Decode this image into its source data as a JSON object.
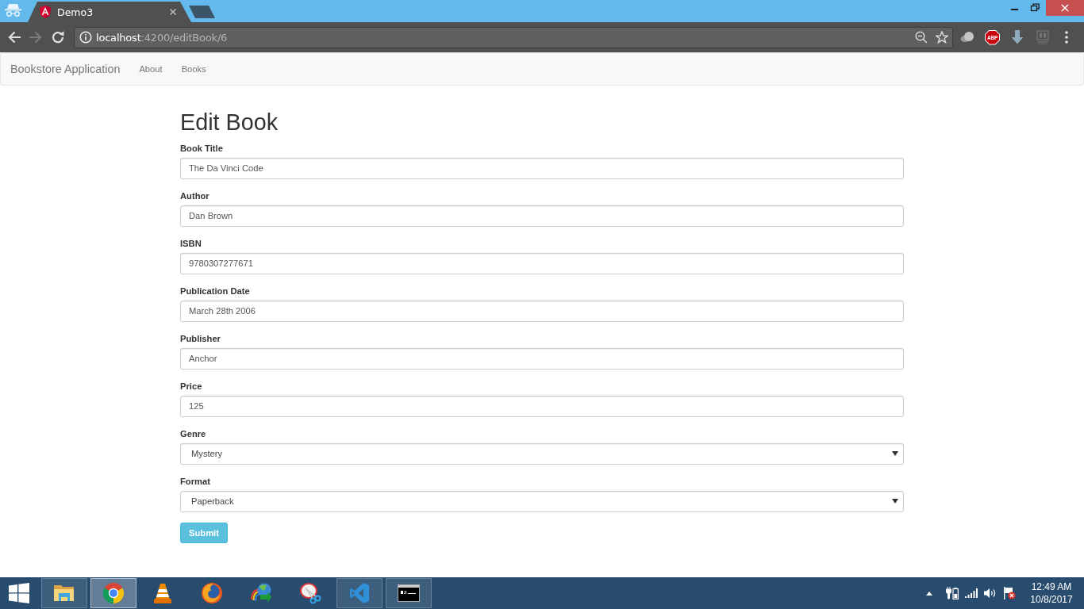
{
  "browser": {
    "tab": {
      "title": "Demo3",
      "selected": true
    },
    "forward_button": {
      "disabled": true
    },
    "address_bar": {
      "host": "localhost",
      "path": ":4200/editBook/6"
    },
    "adblock_badge": "ABP"
  },
  "navbar": {
    "brand": "Bookstore Application",
    "links": [
      {
        "label": "About"
      },
      {
        "label": "Books"
      }
    ]
  },
  "form": {
    "heading": "Edit Book",
    "fields": [
      {
        "kind": "text",
        "label": "Book Title",
        "value": "The Da Vinci Code"
      },
      {
        "kind": "text",
        "label": "Author",
        "value": "Dan Brown"
      },
      {
        "kind": "text",
        "label": "ISBN",
        "value": "9780307277671"
      },
      {
        "kind": "text",
        "label": "Publication Date",
        "value": "March 28th 2006"
      },
      {
        "kind": "text",
        "label": "Publisher",
        "value": "Anchor"
      },
      {
        "kind": "text",
        "label": "Price",
        "value": "125"
      },
      {
        "kind": "select",
        "label": "Genre",
        "value": "Mystery"
      },
      {
        "kind": "select",
        "label": "Format",
        "value": "Paperback"
      }
    ],
    "submit": "Submit"
  },
  "taskbar": {
    "apps": [
      {
        "kind": "folder",
        "running": true,
        "selected": false
      },
      {
        "kind": "browser",
        "running": true,
        "selected": true
      },
      {
        "kind": "cone",
        "running": false,
        "selected": false
      },
      {
        "kind": "globe",
        "running": false,
        "selected": false
      },
      {
        "kind": "download",
        "running": false,
        "selected": false
      },
      {
        "kind": "scissors",
        "running": false,
        "selected": false
      },
      {
        "kind": "editor",
        "running": true,
        "selected": false
      },
      {
        "kind": "terminal",
        "running": true,
        "selected": false
      }
    ],
    "clock": {
      "time": "12:49 AM",
      "date": "10/8/2017"
    }
  }
}
